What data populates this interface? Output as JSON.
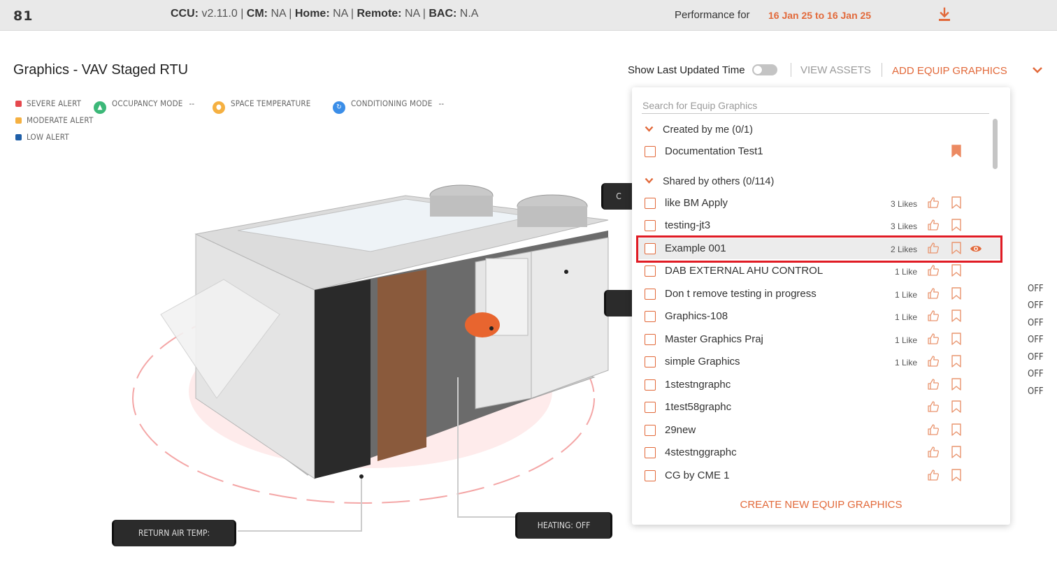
{
  "topbar": {
    "site_id": "81",
    "ccu_label": "CCU:",
    "ccu_value": " v2.11.0 | ",
    "cm_label": "CM:",
    "cm_value": " NA | ",
    "home_label": "Home:",
    "home_value": " NA | ",
    "remote_label": "Remote:",
    "remote_value": " NA | ",
    "bac_label": "BAC:",
    "bac_value": " N.A",
    "performance_label": "Performance for",
    "performance_dates": "16 Jan 25 to 16 Jan 25",
    "download_icon": "download-icon"
  },
  "page": {
    "title": "Graphics - VAV Staged RTU"
  },
  "legend": {
    "severe": "SEVERE ALERT",
    "moderate": "MODERATE ALERT",
    "low": "LOW ALERT",
    "occupancy": "OCCUPANCY MODE",
    "occupancy_value": "--",
    "space_temp": "SPACE TEMPERATURE",
    "conditioning": "CONDITIONING MODE",
    "conditioning_value": "--",
    "colors": {
      "severe": "#e5484d",
      "moderate": "#f5b041",
      "low": "#1f5fa8",
      "occupancy": "#3cb878",
      "space_temp": "#f5b041",
      "conditioning": "#3b8ee8"
    }
  },
  "toolbar": {
    "show_last_updated_label": "Show Last Updated Time",
    "show_last_updated_on": false,
    "view_assets": "VIEW ASSETS",
    "add_equip_graphics": "ADD EQUIP GRAPHICS"
  },
  "scene": {
    "return_air_tag": "RETURN AIR TEMP:",
    "heating_tag": "HEATING: OFF",
    "top_tag_fragment": "C",
    "off_values": [
      "OFF",
      "OFF",
      "OFF",
      "OFF",
      "OFF",
      "OFF",
      "OFF"
    ]
  },
  "dropdown": {
    "search_placeholder": "Search for Equip Graphics",
    "created_group": "Created by me (0/1)",
    "created_items": [
      {
        "name": "Documentation Test1",
        "likes": "",
        "bookmarked": true
      }
    ],
    "shared_group": "Shared by others (0/114)",
    "shared_items": [
      {
        "name": "like BM Apply",
        "likes": "3 Likes"
      },
      {
        "name": "testing-jt3",
        "likes": "3 Likes"
      },
      {
        "name": "Example 001",
        "likes": "2 Likes",
        "highlighted": true,
        "viewing": true
      },
      {
        "name": "DAB EXTERNAL AHU CONTROL",
        "likes": "1 Like"
      },
      {
        "name": "Don t remove testing in progress",
        "likes": "1 Like"
      },
      {
        "name": "Graphics-108",
        "likes": "1 Like"
      },
      {
        "name": "Master Graphics Praj",
        "likes": "1 Like"
      },
      {
        "name": "simple Graphics",
        "likes": "1 Like"
      },
      {
        "name": "1stestngraphc",
        "likes": ""
      },
      {
        "name": "1test58graphc",
        "likes": ""
      },
      {
        "name": "29new",
        "likes": ""
      },
      {
        "name": "4stestnggraphc",
        "likes": ""
      },
      {
        "name": "CG by CME 1",
        "likes": ""
      }
    ],
    "create_new": "CREATE NEW EQUIP GRAPHICS",
    "accent_color": "#e2693a",
    "highlight_border_color": "#e01b24"
  }
}
